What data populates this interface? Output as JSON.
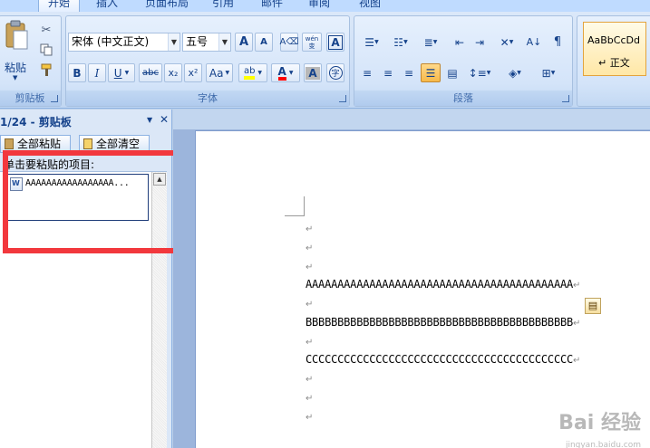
{
  "ribbon": {
    "tabs": [
      "开始",
      "插入",
      "页面布局",
      "引用",
      "邮件",
      "审阅",
      "视图"
    ],
    "clipboard": {
      "paste_label": "粘贴",
      "group_label": "剪贴板"
    },
    "font": {
      "font_name": "宋体 (中文正文)",
      "font_size": "五号",
      "group_label": "字体",
      "bold": "B",
      "italic": "I",
      "underline": "U",
      "strike": "abc",
      "subscript": "x₂",
      "superscript": "x²",
      "change_case": "Aa",
      "grow": "A",
      "shrink": "A",
      "phonetic": "wén 变",
      "char_border": "A",
      "highlight_label": "ab",
      "font_color_label": "A",
      "char_shade": "A",
      "enclose": "字"
    },
    "paragraph": {
      "group_label": "段落"
    },
    "styles": {
      "preview": "AaBbCcDd",
      "name": "↵ 正文"
    }
  },
  "clipboard_pane": {
    "title": "1/24 - 剪贴板",
    "paste_all": "全部粘贴",
    "clear_all": "全部清空",
    "instruction": "单击要粘贴的项目:",
    "items": [
      "AAAAAAAAAAAAAAAAA..."
    ]
  },
  "document": {
    "paragraphs": [
      "",
      "",
      "",
      "AAAAAAAAAAAAAAAAAAAAAAAAAAAAAAAAAAAAAAAAAA",
      "",
      "BBBBBBBBBBBBBBBBBBBBBBBBBBBBBBBBBBBBBBBBBB",
      "",
      "CCCCCCCCCCCCCCCCCCCCCCCCCCCCCCCCCCCCCCCCCC",
      "",
      "",
      ""
    ],
    "paragraph_mark": "↵"
  },
  "watermark": {
    "brand": "Bai 经验",
    "url": "jingyan.baidu.com"
  },
  "colors": {
    "highlight_frame": "#f2383d",
    "ribbon_text": "#15428b"
  }
}
